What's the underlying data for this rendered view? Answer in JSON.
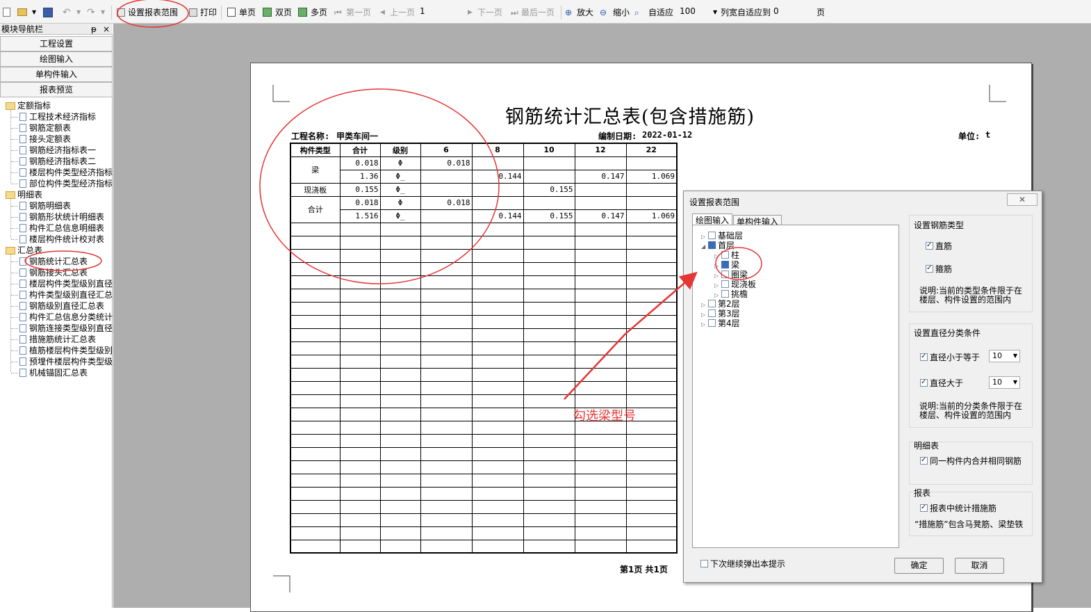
{
  "toolbar": {
    "report_range": "设置报表范围",
    "print": "打印",
    "single_page": "单页",
    "double_page": "双页",
    "multi_page": "多页",
    "first_page": "第一页",
    "prev_page": "上一页",
    "page_value": "1",
    "next_page": "下一页",
    "last_page": "最后一页",
    "zoom_in": "放大",
    "zoom_out": "缩小",
    "fit": "自适应",
    "zoom_value": "100",
    "col_fit": "列宽自适应到",
    "col_fit_value": "0",
    "col_fit_unit": "页"
  },
  "sidebar": {
    "title": "模块导航栏",
    "pin": "ᵽ",
    "close": "×",
    "nav_buttons": [
      "工程设置",
      "绘图输入",
      "单构件输入",
      "报表预览"
    ],
    "groups": [
      {
        "label": "定额指标",
        "items": [
          "工程技术经济指标",
          "钢筋定额表",
          "接头定额表",
          "钢筋经济指标表一",
          "钢筋经济指标表二",
          "楼层构件类型经济指标",
          "部位构件类型经济指标"
        ]
      },
      {
        "label": "明细表",
        "items": [
          "钢筋明细表",
          "钢筋形状统计明细表",
          "构件汇总信息明细表",
          "楼层构件统计校对表"
        ]
      },
      {
        "label": "汇总表",
        "items": [
          "钢筋统计汇总表",
          "钢筋接头汇总表",
          "楼层构件类型级别直径",
          "构件类型级别直径汇总",
          "钢筋级别直径汇总表",
          "构件汇总信息分类统计",
          "钢筋连接类型级别直径",
          "措施筋统计汇总表",
          "植筋楼层构件类型级别",
          "预埋件楼层构件类型级",
          "机械锚固汇总表"
        ]
      }
    ]
  },
  "report": {
    "title": "钢筋统计汇总表(包含措施筋)",
    "project_label": "工程名称:",
    "project_value": "甲类车间一",
    "date_label": "编制日期:",
    "date_value": "2022-01-12",
    "unit_label": "单位:",
    "unit_value": "t",
    "headers": [
      "构件类型",
      "合计",
      "级别",
      "6",
      "8",
      "10",
      "12",
      "22"
    ],
    "rows": [
      {
        "type": "梁",
        "lines": [
          [
            "0.018",
            "Φ",
            "0.018",
            "",
            "",
            "",
            ""
          ],
          [
            "1.36",
            "Φ̲",
            "",
            "0.144",
            "",
            "0.147",
            "1.069"
          ]
        ]
      },
      {
        "type": "现浇板",
        "lines": [
          [
            "0.155",
            "Φ̲",
            "",
            "",
            "0.155",
            "",
            ""
          ]
        ]
      },
      {
        "type": "合计",
        "lines": [
          [
            "0.018",
            "Φ",
            "0.018",
            "",
            "",
            "",
            ""
          ],
          [
            "1.516",
            "Φ̲",
            "",
            "0.144",
            "0.155",
            "0.147",
            "1.069"
          ]
        ]
      }
    ],
    "footer": "第1页 共1页"
  },
  "dialog": {
    "title": "设置报表范围",
    "close": "✕",
    "tabs": [
      "绘图输入",
      "单构件输入"
    ],
    "tree": [
      {
        "label": "基础层",
        "level": 0,
        "expanded": false,
        "state": "off"
      },
      {
        "label": "首层",
        "level": 0,
        "expanded": true,
        "state": "part"
      },
      {
        "label": "柱",
        "level": 1,
        "expanded": false,
        "state": "off"
      },
      {
        "label": "梁",
        "level": 1,
        "expanded": false,
        "state": "part"
      },
      {
        "label": "圈梁",
        "level": 1,
        "expanded": false,
        "state": "off"
      },
      {
        "label": "现浇板",
        "level": 1,
        "expanded": false,
        "state": "off"
      },
      {
        "label": "挑檐",
        "level": 1,
        "expanded": false,
        "state": "off"
      },
      {
        "label": "第2层",
        "level": 0,
        "expanded": false,
        "state": "off"
      },
      {
        "label": "第3层",
        "level": 0,
        "expanded": false,
        "state": "off"
      },
      {
        "label": "第4层",
        "level": 0,
        "expanded": false,
        "state": "off"
      }
    ],
    "rebar_type": {
      "label": "设置钢筋类型",
      "straight": "直筋",
      "stirrup": "箍筋",
      "note": "说明:当前的类型条件限于在楼层、构件设置的范围内"
    },
    "diameter": {
      "label": "设置直径分类条件",
      "le_label": "直径小于等于",
      "le_value": "10",
      "gt_label": "直径大于",
      "gt_value": "10",
      "note": "说明:当前的分类条件限于在楼层、构件设置的范围内"
    },
    "detail": {
      "label": "明细表",
      "merge": "同一构件内合并相同钢筋"
    },
    "report_group": {
      "label": "报表",
      "measures": "报表中统计措施筋",
      "note": "“措施筋”包含马凳筋、梁垫铁"
    },
    "dont_show": "下次继续弹出本提示",
    "ok": "确定",
    "cancel": "取消"
  },
  "annotation": "勾选梁型号",
  "colors": {
    "annotation_red": "#e53535",
    "workarea": "#aeaeae",
    "tree_check": "#3a6db5"
  }
}
